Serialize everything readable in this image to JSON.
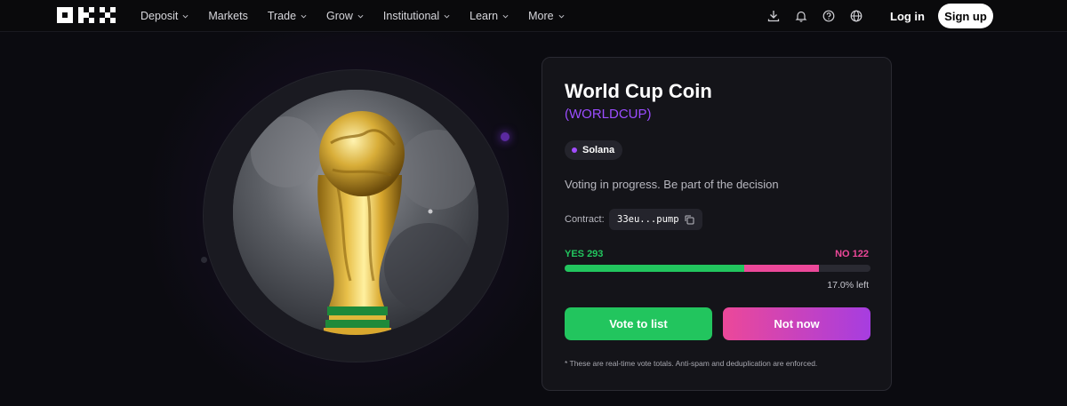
{
  "nav": {
    "logo": "OKX",
    "menu": [
      {
        "label": "Deposit",
        "dropdown": true
      },
      {
        "label": "Markets",
        "dropdown": false
      },
      {
        "label": "Trade",
        "dropdown": true
      },
      {
        "label": "Grow",
        "dropdown": true
      },
      {
        "label": "Institutional",
        "dropdown": true
      },
      {
        "label": "Learn",
        "dropdown": true
      },
      {
        "label": "More",
        "dropdown": true
      }
    ],
    "icons": [
      "download-icon",
      "bell-icon",
      "help-icon",
      "globe-icon"
    ],
    "login_label": "Log in",
    "signup_label": "Sign up"
  },
  "token": {
    "name": "World Cup Coin",
    "ticker": "(WORLDCUP)",
    "chain": "Solana",
    "status_text": "Voting in progress. Be part of the decision",
    "contract_label": "Contract:",
    "contract_value": "33eu...pump",
    "image": "world-cup-trophy"
  },
  "vote": {
    "yes_label": "YES 293",
    "no_label": "NO 122",
    "yes_count": 293,
    "no_count": 122,
    "remaining_fraction": 0.17,
    "remaining_label": "17.0% left",
    "vote_button": "Vote to list",
    "decline_button": "Not now",
    "footnote": "* These are real-time vote totals. Anti-spam and deduplication are enforced."
  },
  "colors": {
    "accent_purple": "#9b4dff",
    "yes_green": "#22c55e",
    "no_pink": "#ec4899",
    "background": "#0b0b10",
    "card": "#141419"
  }
}
